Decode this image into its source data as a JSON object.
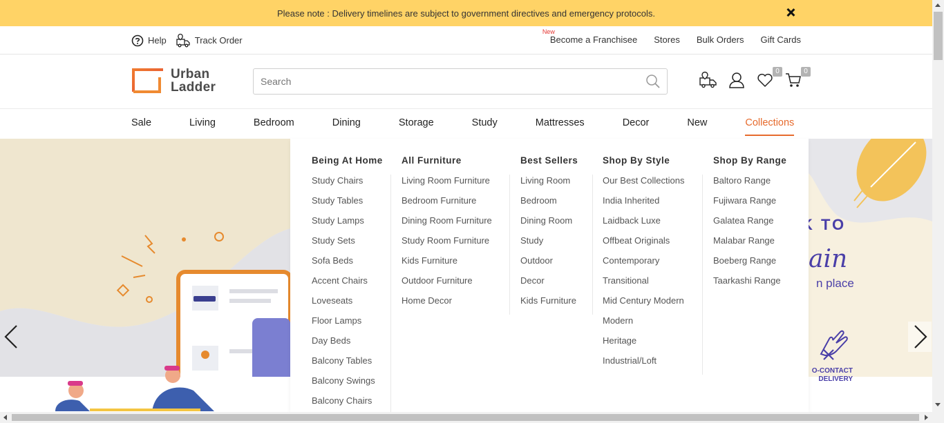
{
  "notice": {
    "text": "Please note : Delivery timelines are subject to government directives and emergency protocols."
  },
  "util": {
    "help": "Help",
    "track_order": "Track Order",
    "new_tag": "New",
    "franchise": "Become a Franchisee",
    "stores": "Stores",
    "bulk_orders": "Bulk Orders",
    "gift_cards": "Gift Cards"
  },
  "header": {
    "logo_line1": "Urban",
    "logo_line2": "Ladder",
    "search_placeholder": "Search",
    "wishlist_count": "0",
    "cart_count": "0",
    "icons": [
      "delivery-truck-icon",
      "user-icon",
      "heart-icon",
      "cart-icon"
    ]
  },
  "nav": {
    "items": [
      "Sale",
      "Living",
      "Bedroom",
      "Dining",
      "Storage",
      "Study",
      "Mattresses",
      "Decor",
      "New",
      "Collections"
    ],
    "active": "Collections"
  },
  "mega": {
    "columns": [
      {
        "title": "Being At Home",
        "items": [
          "Study Chairs",
          "Study Tables",
          "Study Lamps",
          "Study Sets",
          "Sofa Beds",
          "Accent Chairs",
          "Loveseats",
          "Floor Lamps",
          "Day Beds",
          "Balcony Tables",
          "Balcony Swings",
          "Balcony Chairs"
        ]
      },
      {
        "title": "All Furniture",
        "items": [
          "Living Room Furniture",
          "Bedroom Furniture",
          "Dining Room Furniture",
          "Study Room Furniture",
          "Kids Furniture",
          "Outdoor Furniture",
          "Home Decor"
        ]
      },
      {
        "title": "Best Sellers",
        "items": [
          "Living Room",
          "Bedroom",
          "Dining Room",
          "Study",
          "Outdoor",
          "Decor",
          "Kids Furniture"
        ]
      },
      {
        "title": "Shop By Style",
        "items": [
          "Our Best Collections",
          "India Inherited",
          "Laidback Luxe",
          "Offbeat Originals",
          "Contemporary",
          "Transitional",
          "Mid Century Modern",
          "Modern",
          "Heritage",
          "Industrial/Loft"
        ]
      },
      {
        "title": "Shop By Range",
        "items": [
          "Baltoro Range",
          "Fujiwara Range",
          "Galatea Range",
          "Malabar Range",
          "Boeberg Range",
          "Taarkashi Range"
        ]
      }
    ]
  },
  "banner": {
    "tagline1": "K TO",
    "tagline2": "ain",
    "tagline3": "n place",
    "no_contact": "O-CONTACT DELIVERY"
  },
  "colors": {
    "notice_bg": "#ffd366",
    "accent": "#e66a2c",
    "banner_purple": "#4a3fa8"
  }
}
